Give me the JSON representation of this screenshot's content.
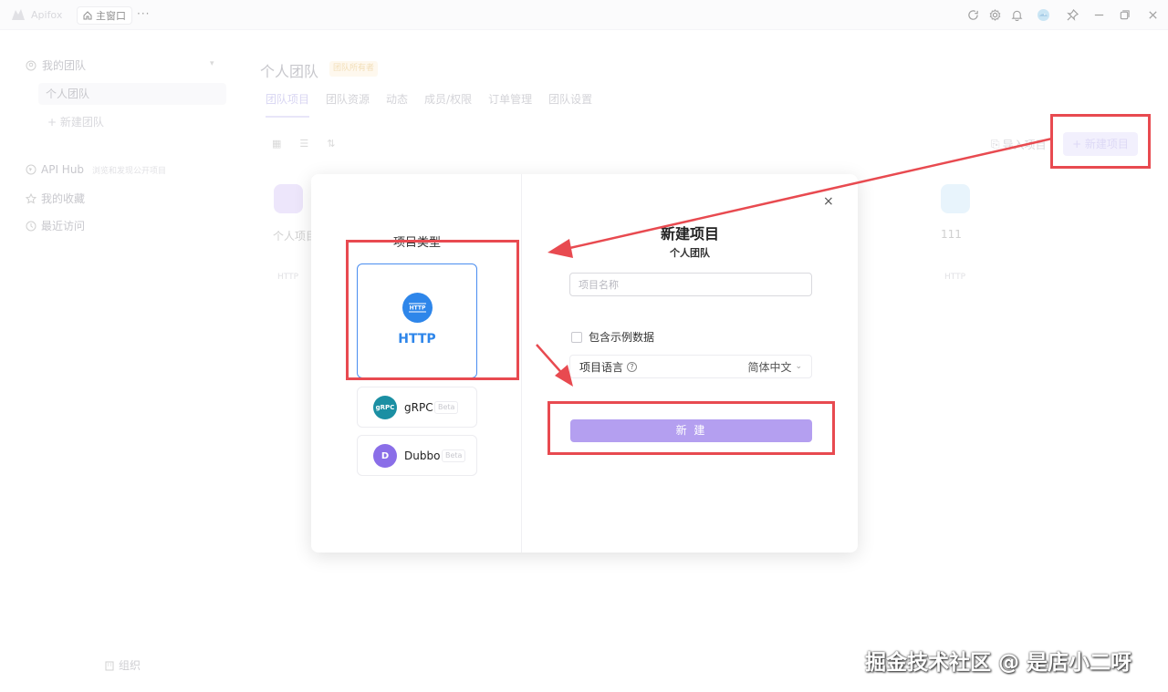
{
  "titlebar": {
    "app_name": "Apifox",
    "main_tab_label": "主窗口",
    "more_label": "···",
    "icons": [
      "refresh-icon",
      "gear-icon",
      "bell-icon",
      "avatar",
      "pin-icon",
      "minimize-icon",
      "maximize-icon",
      "close-icon"
    ]
  },
  "sidebar": {
    "team_header": "我的团队",
    "team_active": "个人团队",
    "new_team": "+ 新建团队",
    "apihub": "API Hub",
    "apihub_sub": "浏览和发现公开项目",
    "favorites": "我的收藏",
    "recent": "最近访问",
    "org": "组织"
  },
  "main": {
    "title": "个人团队",
    "plan_badge": "团队所有者",
    "tabs": [
      "团队项目",
      "团队资源",
      "动态",
      "成员/权限",
      "订单管理",
      "团队设置"
    ],
    "import_label": "导入项目",
    "new_project_label": "+ 新建项目",
    "projects": [
      {
        "name": "个人项目",
        "type": "HTTP",
        "color": "#c9b8f0"
      },
      {
        "name": "111",
        "type": "HTTP",
        "color": "#bfe0f7"
      }
    ]
  },
  "modal": {
    "type_title": "项目类型",
    "types": [
      {
        "label": "HTTP",
        "icon_text": "HTTP",
        "beta": ""
      },
      {
        "label": "gRPC",
        "icon_text": "gRPC",
        "beta": "Beta"
      },
      {
        "label": "Dubbo",
        "icon_text": "D",
        "beta": "Beta"
      }
    ],
    "close_label": "×",
    "title": "新建项目",
    "subtitle": "个人团队",
    "name_placeholder": "项目名称",
    "sample_label": "包含示例数据",
    "lang_label": "项目语言",
    "lang_value": "简体中文",
    "create_label": "新 建"
  },
  "colors": {
    "accent": "#b49ff0",
    "http_blue": "#2e86ea",
    "annotation_red": "#e84a50"
  },
  "watermark": "掘金技术社区 @ 是店小二呀"
}
